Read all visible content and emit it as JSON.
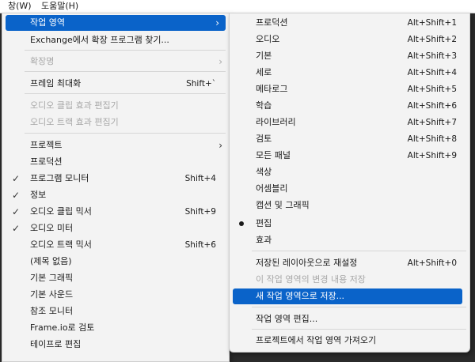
{
  "menubar": {
    "window_label": "창(W)",
    "help_label": "도움말(H)"
  },
  "main_menu": {
    "items": [
      {
        "label": "작업 영역",
        "arrow": "›"
      },
      {
        "label": "Exchange에서 확장 프로그램 찾기..."
      },
      {
        "label": "확장명",
        "arrow": "›"
      },
      {
        "label": "프레임 최대화",
        "shortcut": "Shift+`"
      },
      {
        "label": "오디오 클립 효과 편집기"
      },
      {
        "label": "오디오 트랙 효과 편집기"
      },
      {
        "label": "프로젝트",
        "arrow": "›"
      },
      {
        "label": "프로덕션"
      },
      {
        "label": "프로그램 모니터",
        "shortcut": "Shift+4",
        "check": "✓"
      },
      {
        "label": "정보",
        "check": "✓"
      },
      {
        "label": "오디오 클립 믹서",
        "shortcut": "Shift+9",
        "check": "✓"
      },
      {
        "label": "오디오 미터",
        "check": "✓"
      },
      {
        "label": "오디오 트랙 믹서",
        "shortcut": "Shift+6"
      },
      {
        "label": "(제목 없음)"
      },
      {
        "label": "기본 그래픽"
      },
      {
        "label": "기본 사운드"
      },
      {
        "label": "참조 모니터"
      },
      {
        "label": "Frame.io로 검토"
      },
      {
        "label": "테이프로 편집"
      }
    ]
  },
  "submenu": {
    "items": [
      {
        "label": "프로덕션",
        "shortcut": "Alt+Shift+1"
      },
      {
        "label": "오디오",
        "shortcut": "Alt+Shift+2"
      },
      {
        "label": "기본",
        "shortcut": "Alt+Shift+3"
      },
      {
        "label": "세로",
        "shortcut": "Alt+Shift+4"
      },
      {
        "label": "메타로그",
        "shortcut": "Alt+Shift+5"
      },
      {
        "label": "학습",
        "shortcut": "Alt+Shift+6"
      },
      {
        "label": "라이브러리",
        "shortcut": "Alt+Shift+7"
      },
      {
        "label": "검토",
        "shortcut": "Alt+Shift+8"
      },
      {
        "label": "모든 패널",
        "shortcut": "Alt+Shift+9"
      },
      {
        "label": "색상"
      },
      {
        "label": "어셈블리"
      },
      {
        "label": "캡션 및 그래픽"
      },
      {
        "label": "편집"
      },
      {
        "label": "효과"
      },
      {
        "label": "저장된 레이아웃으로 재설정",
        "shortcut": "Alt+Shift+0"
      },
      {
        "label": "이 작업 영역의 변경 내용 저장"
      },
      {
        "label": "새 작업 영역으로 저장..."
      },
      {
        "label": "작업 영역 편집..."
      },
      {
        "label": "프로젝트에서 작업 영역 가져오기"
      }
    ]
  }
}
